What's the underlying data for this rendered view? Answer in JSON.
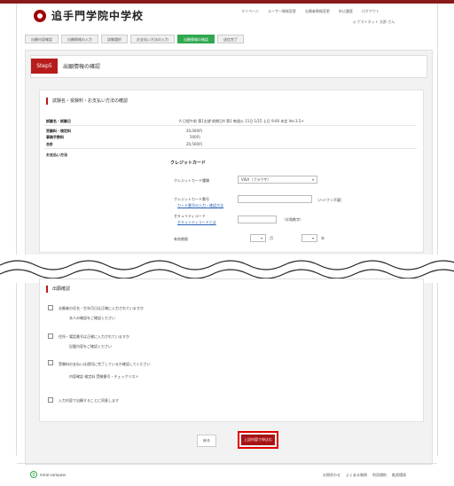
{
  "header": {
    "school_name": "追手門学院中学校",
    "links": [
      "マイページ",
      "ユーザー情報変更",
      "志願者情報変更",
      "申込履歴",
      "ログアウト"
    ],
    "user": "◎ ゲストネット 太郎 さん"
  },
  "steps": [
    "出願内容確認",
    "出願情報の入力",
    "試験選択",
    "お支払い方法の入力",
    "出願情報の確認",
    "送信完了"
  ],
  "active_step_index": 4,
  "page": {
    "step_badge": "Step5",
    "title": "出願情報の確認"
  },
  "payment_section": {
    "title": "試験名・受験料・お支払い方法の確認",
    "exam_header_label": "試験名・試験日",
    "exam_header_value": "A 日程午前 第1志望  前期日A 第1  毎週火 11日  1/15 土日  9:00 未定  Ver.3.5+",
    "rows": [
      {
        "label": "受験料・検定料",
        "value": "20,000円"
      },
      {
        "label": "事務手数料",
        "value": "500円"
      },
      {
        "label": "合計",
        "value": "20,500円"
      }
    ],
    "pay_method_label": "お支払い方法",
    "pay_method_value": "クレジットカード",
    "card_type_label": "クレジットカード種類",
    "card_type_value": "VISA（ブラウザ）",
    "card_number_label": "クレジットカード番号",
    "card_number_help": "カード番号の入力・確認方法",
    "card_number_hint": "（ハイフン不要）",
    "security_label": "セキュリティコード",
    "security_help": "セキュリティコードとは",
    "security_hint": "（半角数字）",
    "expiry_label": "有効期限",
    "expiry_month_unit": "月",
    "expiry_year_unit": "年"
  },
  "consent_section": {
    "title": "出願確認",
    "items": [
      {
        "text": "志願者の氏名・生年月日は正確に入力されていますか",
        "note": "本人の確認をご確認ください"
      },
      {
        "text": "住所・電話番号は正確に入力されていますか",
        "note": "記載内容をご確認ください"
      },
      {
        "text": "受験料の支払いは適切に完了しているか確認してください",
        "note": "内容確認  検定料  受験番号・チェックリスト"
      },
      {
        "text": "入力内容で出願することに同意します",
        "note": ""
      }
    ]
  },
  "actions": {
    "back_label": "戻る",
    "confirm_label": "上記内容で申込む"
  },
  "footer": {
    "brand": "mirai-compass",
    "links": [
      "お問合わせ",
      "よくある質問",
      "利用規約",
      "推奨環境"
    ]
  }
}
